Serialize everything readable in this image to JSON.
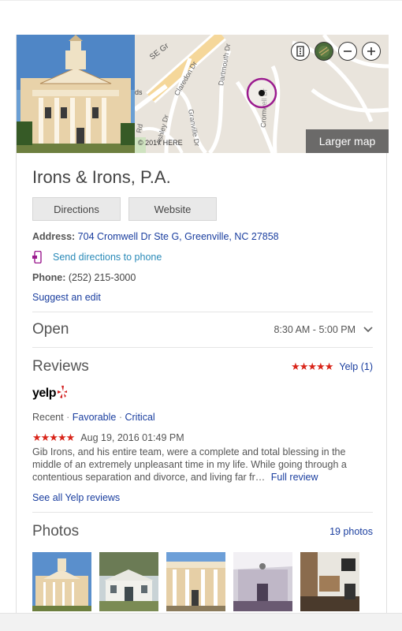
{
  "map": {
    "street_labels": [
      "SE Gr",
      "Claredon Dr",
      "Granville Dr",
      "Dartmouth Dr",
      "Cromwell Dr",
      "Ashley Dr",
      "Rd",
      "ds"
    ],
    "copyright": "© 2017 HERE",
    "larger_map_label": "Larger map",
    "controls": [
      "tile-grid-icon",
      "globe-icon",
      "zoom-out-icon",
      "zoom-in-icon"
    ]
  },
  "business": {
    "name": "Irons & Irons, P.A.",
    "directions_label": "Directions",
    "website_label": "Website",
    "address_label": "Address:",
    "address_value": "704 Cromwell Dr Ste G, Greenville, NC 27858",
    "send_to_phone": "Send directions to phone",
    "phone_label": "Phone:",
    "phone_value": "(252) 215-3000",
    "suggest_edit": "Suggest an edit"
  },
  "hours": {
    "status": "Open",
    "range": "8:30 AM - 5:00 PM"
  },
  "reviews": {
    "title": "Reviews",
    "stars": "★★★★★",
    "source_count": "Yelp (1)",
    "logo_text": "yelp",
    "filter_recent": "Recent",
    "filter_sep1": "·",
    "filter_favorable": "Favorable",
    "filter_sep2": "·",
    "filter_critical": "Critical",
    "review_stars": "★★★★★",
    "review_date": "Aug 19, 2016 01:49 PM",
    "review_text": "Gib Irons, and his entire team, were a complete and total blessing in the middle of an extremely unpleasant time in my life. While going through a contentious separation and divorce, and living far fr…",
    "full_review": "Full review",
    "see_all": "See all Yelp reviews"
  },
  "photos": {
    "title": "Photos",
    "count": "19 photos"
  },
  "colors": {
    "link": "#1a3e9f",
    "teal_link": "#2a8ab8",
    "star": "#d9251a",
    "pin": "#9b1b8f"
  }
}
